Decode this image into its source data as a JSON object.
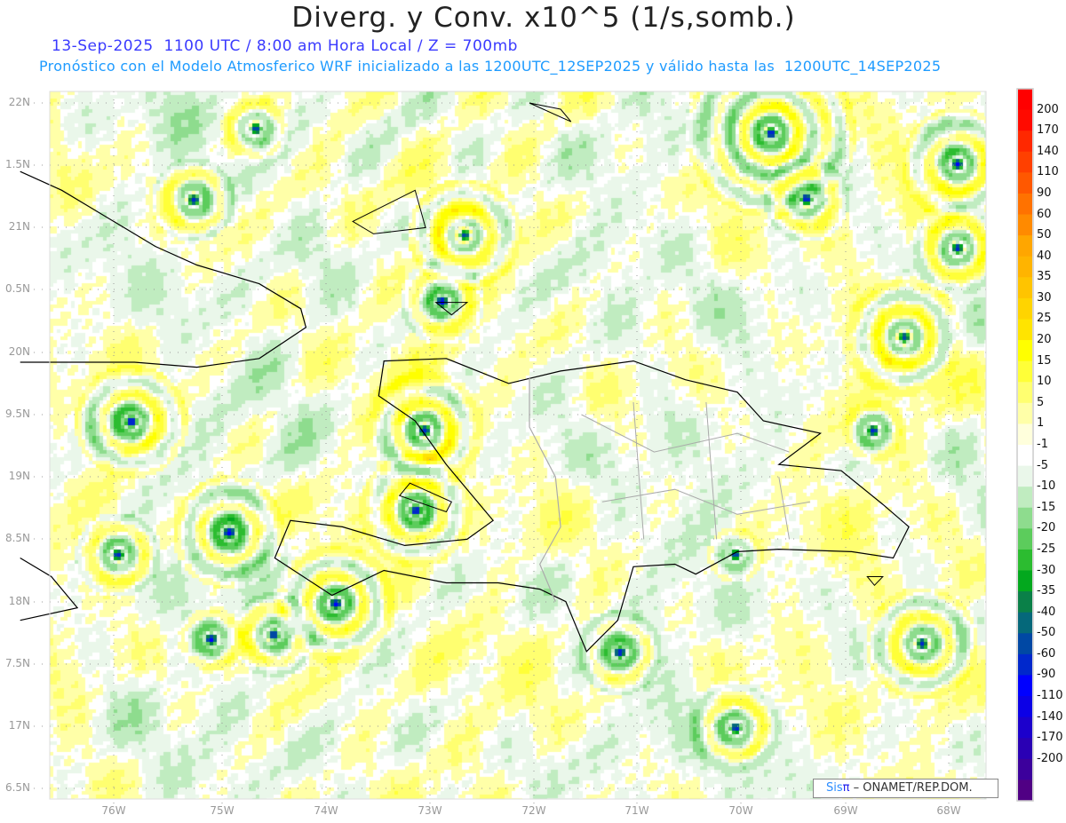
{
  "header": {
    "title": "Diverg. y Conv. x10^5 (1/s,somb.)",
    "valid_time_line": "13-Sep-2025  1100 UTC / 8:00 am Hora Local / Z = 700mb",
    "model_line": "Pronóstico con el Modelo Atmosferico WRF inicializado a las 1200UTC_12SEP2025 y válido hasta las  1200UTC_14SEP2025"
  },
  "map": {
    "lat_labels": [
      "22N",
      "1.5N",
      "21N",
      "0.5N",
      "20N",
      "9.5N",
      "19N",
      "8.5N",
      "18N",
      "7.5N",
      "17N",
      "6.5N"
    ],
    "lon_labels": [
      "76W",
      "75W",
      "74W",
      "73W",
      "72W",
      "71W",
      "70W",
      "69W",
      "68W"
    ],
    "grid": true,
    "regions_shown": [
      "Hispaniola",
      "Eastern Cuba",
      "Jamaica (east tip)",
      "Turks and Caicos / Inagua"
    ]
  },
  "colorbar": {
    "labels": [
      "200",
      "170",
      "140",
      "110",
      "90",
      "60",
      "50",
      "40",
      "35",
      "30",
      "25",
      "20",
      "15",
      "10",
      "5",
      "1",
      "-1",
      "-5",
      "-10",
      "-15",
      "-20",
      "-25",
      "-30",
      "-35",
      "-40",
      "-50",
      "-60",
      "-90",
      "-110",
      "-140",
      "-170",
      "-200"
    ],
    "colors": [
      "#ff0000",
      "#ff0a00",
      "#ff2800",
      "#ff4000",
      "#ff5800",
      "#ff7200",
      "#ff8a00",
      "#ffa600",
      "#ffb400",
      "#ffc400",
      "#ffd400",
      "#ffe400",
      "#ffff00",
      "#ffff38",
      "#ffff70",
      "#ffffa8",
      "#ffffdc",
      "#ffffff",
      "#eaf7ea",
      "#c0ecc0",
      "#8edc8e",
      "#5ccc5c",
      "#2cbc30",
      "#03a81e",
      "#0a8048",
      "#05687a",
      "#0048a4",
      "#0028cc",
      "#0000ff",
      "#0c00e6",
      "#1c00cc",
      "#2a00b4",
      "#3c009c",
      "#500084"
    ]
  },
  "credit": {
    "brand": "Sis",
    "brand_symbol": "π",
    "text": "– ONAMET/REP.DOM."
  }
}
